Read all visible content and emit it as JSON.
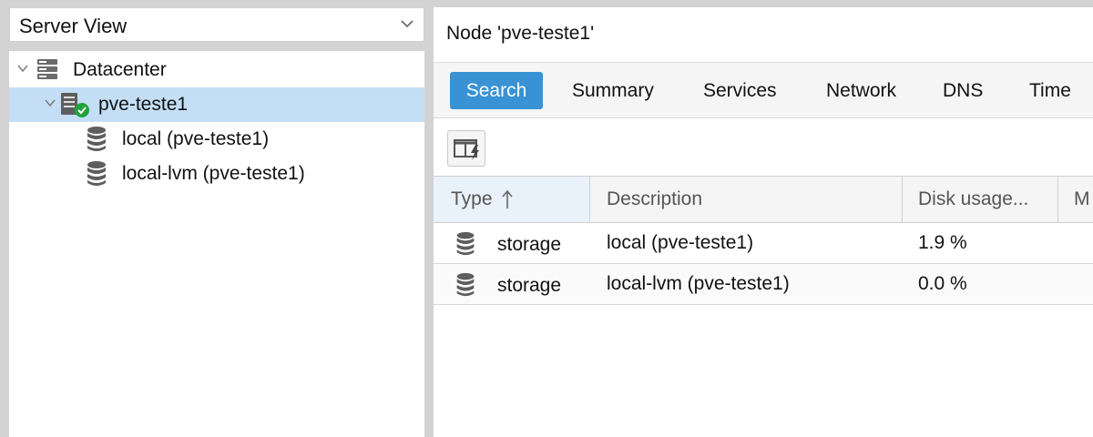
{
  "view_selector": {
    "label": "Server View"
  },
  "tree": {
    "datacenter": {
      "label": "Datacenter",
      "icon": "datacenter-icon"
    },
    "node": {
      "label": "pve-teste1",
      "icon": "node-online-icon",
      "status_color": "#21a33c"
    },
    "storages": [
      {
        "label": "local (pve-teste1)",
        "icon": "storage-icon"
      },
      {
        "label": "local-lvm (pve-teste1)",
        "icon": "storage-icon"
      }
    ]
  },
  "panel": {
    "title": "Node 'pve-teste1'",
    "tabs": [
      {
        "label": "Search",
        "active": true
      },
      {
        "label": "Summary"
      },
      {
        "label": "Services"
      },
      {
        "label": "Network"
      },
      {
        "label": "DNS"
      },
      {
        "label": "Time"
      }
    ],
    "accent_color": "#3892d4"
  },
  "grid": {
    "columns": [
      {
        "label": "Type",
        "sort": "ascending"
      },
      {
        "label": "Description"
      },
      {
        "label": "Disk usage..."
      },
      {
        "label": "M"
      }
    ],
    "sort_icon": "sort-ascending-icon",
    "rows": [
      {
        "type": "storage",
        "description": "local (pve-teste1)",
        "disk_usage": "1.9 %"
      },
      {
        "type": "storage",
        "description": "local-lvm (pve-teste1)",
        "disk_usage": "0.0 %"
      }
    ]
  }
}
